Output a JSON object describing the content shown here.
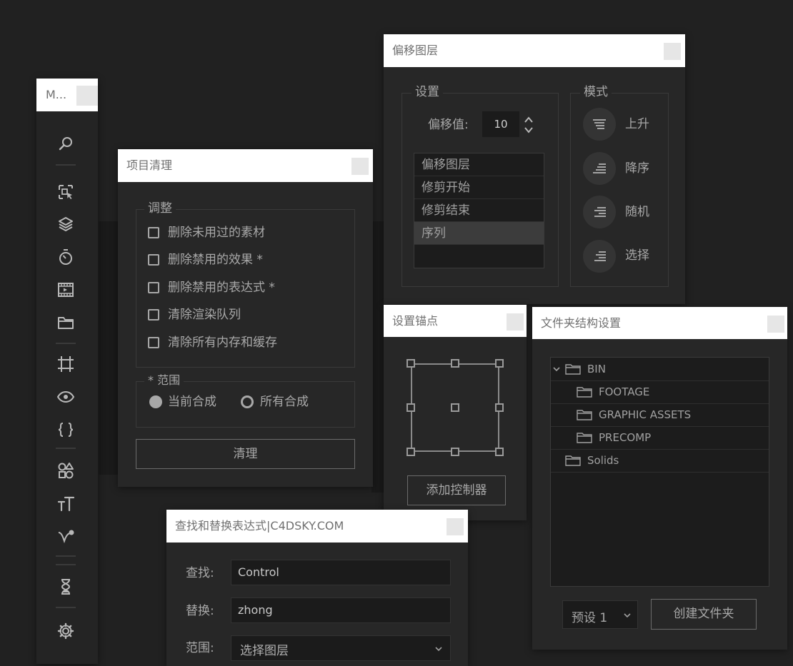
{
  "sidebar": {
    "title": "M..."
  },
  "project_cleanup": {
    "title": "项目清理",
    "adjust_label": "调整",
    "options": [
      "删除未用过的素材",
      "删除禁用的效果 *",
      "删除禁用的表达式 *",
      "清除渲染队列",
      "清除所有内存和缓存"
    ],
    "scope_label": "* 范围",
    "scope_options": [
      "当前合成",
      "所有合成"
    ],
    "clean_button": "清理"
  },
  "offset_layers": {
    "title": "偏移图层",
    "settings_label": "设置",
    "offset_label": "偏移值:",
    "offset_value": "10",
    "list_items": [
      "偏移图层",
      "修剪开始",
      "修剪结束",
      "序列"
    ],
    "mode_label": "模式",
    "modes": [
      "上升",
      "降序",
      "随机",
      "选择"
    ]
  },
  "anchor_point": {
    "title": "设置锚点",
    "add_controller_button": "添加控制器"
  },
  "folder_structure": {
    "title": "文件夹结构设置",
    "tree": [
      "BIN",
      "FOOTAGE",
      "GRAPHIC ASSETS",
      "PRECOMP",
      "Solids"
    ],
    "preset_value": "预设 1",
    "create_button": "创建文件夹"
  },
  "find_replace": {
    "title": "查找和替换表达式|C4DSKY.COM",
    "find_label": "查找:",
    "find_value": "Control",
    "replace_label": "替换:",
    "replace_value": "zhong",
    "scope_label": "范围:",
    "scope_value": "选择图层"
  },
  "colors": {
    "background": "#212121",
    "panel": "#272727",
    "titlebar": "#ffffff",
    "text": "#a8a8a8"
  }
}
